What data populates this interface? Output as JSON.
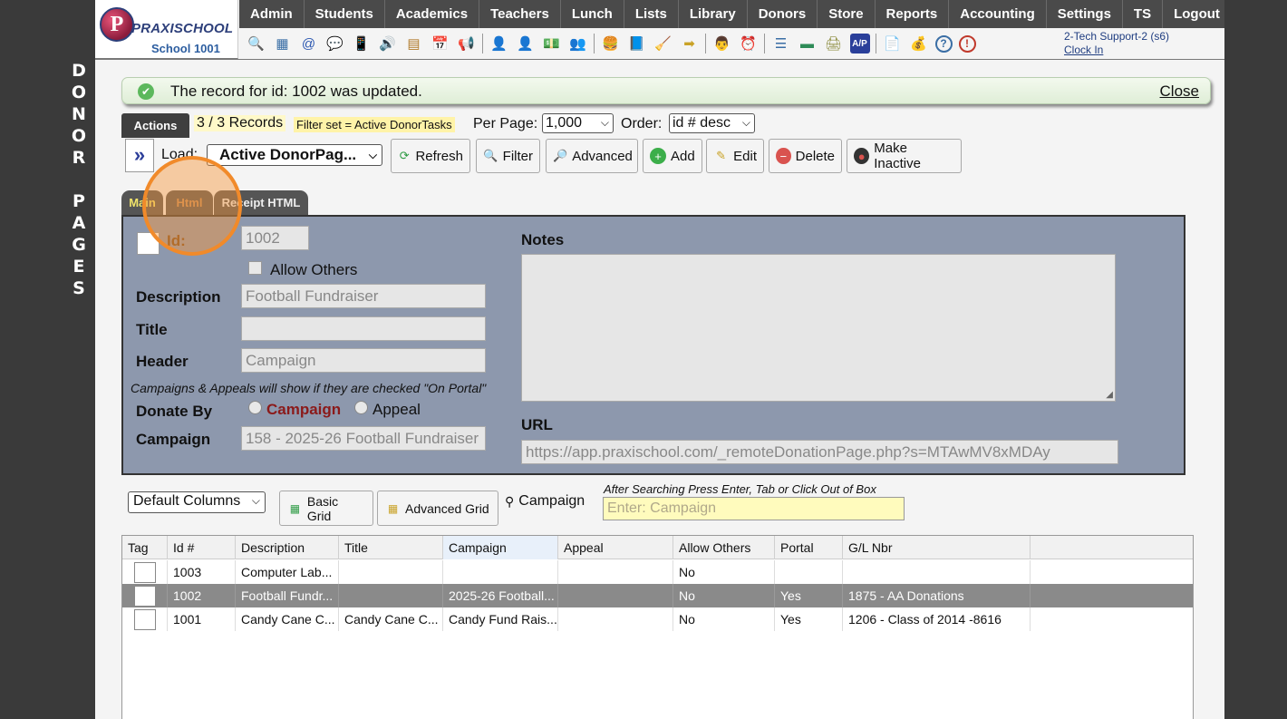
{
  "side_title": [
    "D",
    "O",
    "N",
    "O",
    "R",
    "",
    "P",
    "A",
    "G",
    "E",
    "S"
  ],
  "logo": {
    "mark": "P",
    "brand": "PRAXISCHOOL",
    "school": "School 1001"
  },
  "menu": [
    "Admin",
    "Students",
    "Academics",
    "Teachers",
    "Lunch",
    "Lists",
    "Library",
    "Donors",
    "Store",
    "Reports",
    "Accounting",
    "Settings",
    "TS",
    "Logout"
  ],
  "toolbar_icons": [
    {
      "name": "search-icon",
      "glyph": "🔍",
      "color": "#5a7ab8"
    },
    {
      "name": "grid-icon",
      "glyph": "▦",
      "color": "#3a6ea5"
    },
    {
      "name": "email-icon",
      "glyph": "@",
      "color": "#2a56b0"
    },
    {
      "name": "chat-icon",
      "glyph": "💬",
      "color": "#2e9b45"
    },
    {
      "name": "phone-icon",
      "glyph": "📱",
      "color": "#333"
    },
    {
      "name": "speaker-icon",
      "glyph": "🔊",
      "color": "#666"
    },
    {
      "name": "report-icon",
      "glyph": "▤",
      "color": "#b07a2a"
    },
    {
      "name": "calendar-icon",
      "glyph": "📅",
      "color": "#c0392b"
    },
    {
      "name": "megaphone-icon",
      "glyph": "📢",
      "color": "#888"
    },
    {
      "sep": true
    },
    {
      "name": "user-red-icon",
      "glyph": "👤",
      "color": "#c0392b"
    },
    {
      "name": "user-blue-icon",
      "glyph": "👤",
      "color": "#2a56b0"
    },
    {
      "name": "money-icon",
      "glyph": "💵",
      "color": "#2e8b57"
    },
    {
      "name": "group-icon",
      "glyph": "👥",
      "color": "#a0522d"
    },
    {
      "sep": true
    },
    {
      "name": "lunch-icon",
      "glyph": "🍔",
      "color": "#c9822b"
    },
    {
      "name": "book-icon",
      "glyph": "📘",
      "color": "#2a56b0"
    },
    {
      "name": "broom-icon",
      "glyph": "🧹",
      "color": "#c9a227"
    },
    {
      "name": "export-icon",
      "glyph": "➡",
      "color": "#c9a227"
    },
    {
      "sep": true
    },
    {
      "name": "teacher-icon",
      "glyph": "👨",
      "color": "#555"
    },
    {
      "name": "clock-icon",
      "glyph": "⏰",
      "color": "#2a56b0"
    },
    {
      "sep": true
    },
    {
      "name": "list-icon",
      "glyph": "☰",
      "color": "#3a6ea5"
    },
    {
      "name": "check-icon",
      "glyph": "▬",
      "color": "#2e8b57"
    },
    {
      "name": "printer-icon",
      "glyph": "🖨",
      "color": "#8a8a3a"
    },
    {
      "name": "ap-icon",
      "glyph": "A/P",
      "color": "#2a3f9a"
    },
    {
      "sep": true
    },
    {
      "name": "pdf-icon",
      "glyph": "📄",
      "color": "#c0392b"
    },
    {
      "name": "cash-register-icon",
      "glyph": "💰",
      "color": "#555"
    },
    {
      "name": "help-icon",
      "glyph": "?",
      "color": "#3a6ea5"
    },
    {
      "name": "alert-icon",
      "glyph": "!",
      "color": "#c0392b"
    }
  ],
  "user": {
    "name": "2-Tech Support-2 (s6)",
    "clock_in": "Clock In"
  },
  "notice": {
    "message": "The record for id: 1002 was updated.",
    "close": "Close"
  },
  "records": {
    "actions": "Actions",
    "count": "3 / 3 Records",
    "filter_set": "Filter set = Active DonorTasks",
    "per_page_label": "Per Page:",
    "per_page_value": "1,000",
    "order_label": "Order:",
    "order_value": "id # desc"
  },
  "toolbar": {
    "load_label": "Load:",
    "load_value": "Active DonorPag...",
    "refresh": "Refresh",
    "filter": "Filter",
    "advanced": "Advanced",
    "add": "Add",
    "edit": "Edit",
    "delete": "Delete",
    "make_inactive": "Make Inactive"
  },
  "tabs": {
    "main": "Main",
    "html": "Html",
    "receipt": "Receipt HTML"
  },
  "form": {
    "id_label": "Id:",
    "id_value": "1002",
    "allow_others": "Allow Others",
    "description_label": "Description",
    "description_value": "Football Fundraiser",
    "title_label": "Title",
    "title_value": "",
    "header_label": "Header",
    "header_value": "Campaign",
    "portal_note": "Campaigns & Appeals will show if they are checked \"On Portal\"",
    "donate_by_label": "Donate By",
    "donate_campaign": "Campaign",
    "donate_appeal": "Appeal",
    "campaign_label": "Campaign",
    "campaign_value": "158 - 2025-26 Football Fundraiser",
    "notes_label": "Notes",
    "notes_value": "",
    "url_label": "URL",
    "url_value": "https://app.praxischool.com/_remoteDonationPage.php?s=MTAwMV8xMDAy"
  },
  "grid_controls": {
    "columns": "Default Columns",
    "basic_grid": "Basic Grid",
    "advanced_grid": "Advanced Grid",
    "campaign_label": "Campaign",
    "search_hint": "After Searching Press Enter, Tab or Click Out of Box",
    "search_placeholder": "Enter: Campaign"
  },
  "grid": {
    "columns": [
      "Tag",
      "Id #",
      "Description",
      "Title",
      "Campaign",
      "Appeal",
      "Allow Others",
      "Portal",
      "G/L Nbr"
    ],
    "rows": [
      [
        "",
        "1003",
        "Computer Lab...",
        "",
        "",
        "",
        "No",
        "",
        ""
      ],
      [
        "",
        "1002",
        "Football Fundr...",
        "",
        "2025-26 Football...",
        "",
        "No",
        "Yes",
        "1875 - AA Donations"
      ],
      [
        "",
        "1001",
        "Candy Cane C...",
        "Candy Cane C...",
        "Candy Fund Rais...",
        "",
        "No",
        "Yes",
        "1206 - Class of 2014 -8616"
      ]
    ],
    "selected_row": 1
  }
}
